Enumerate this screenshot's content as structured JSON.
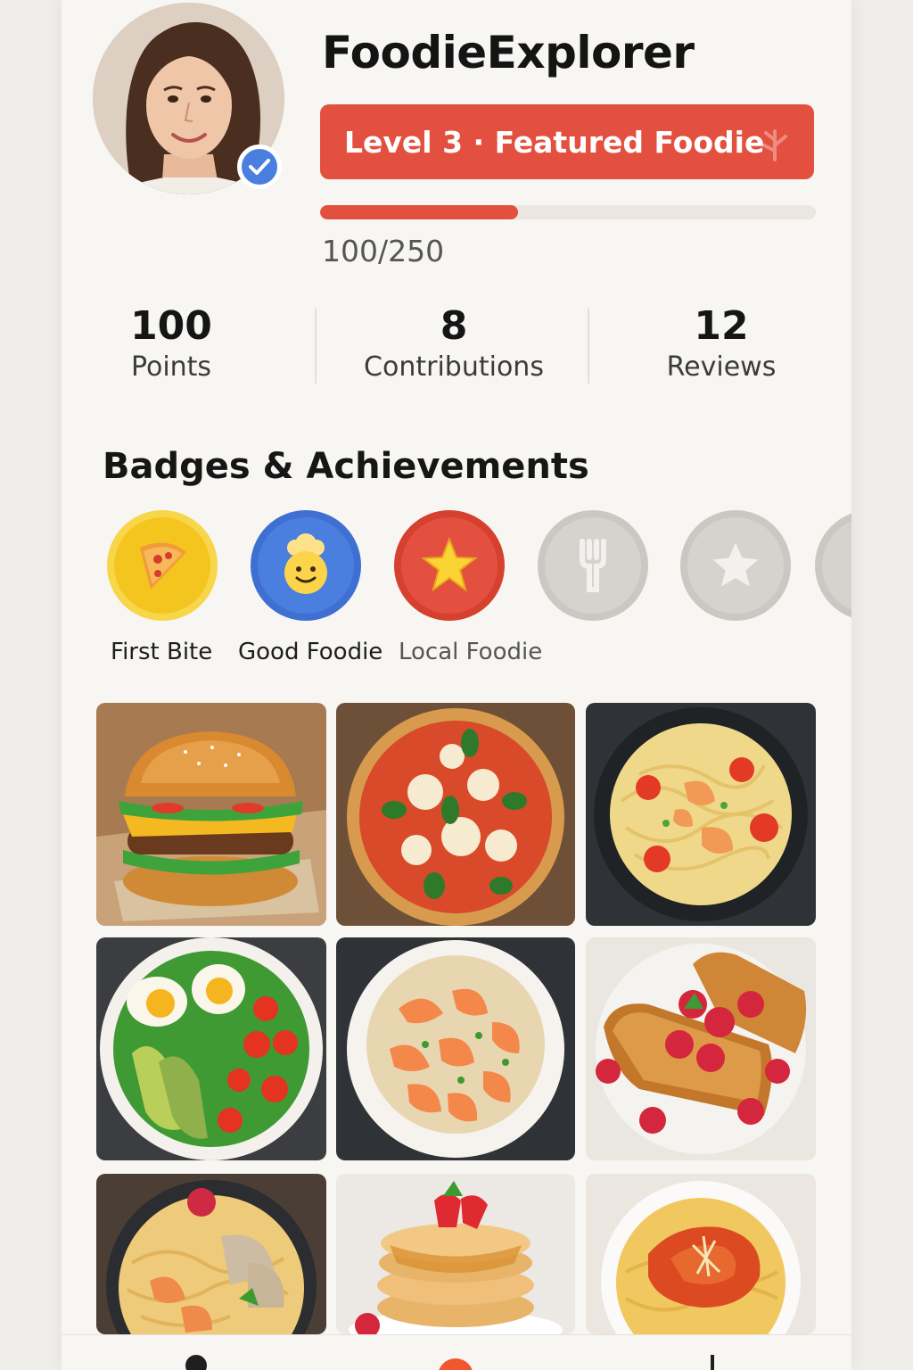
{
  "profile": {
    "username": "FoodieExplorer",
    "avatar_icon": "user-avatar-photo",
    "verified": true,
    "level_label": "Level 3 · Featured Foodie",
    "progress_current": 100,
    "progress_max": 250,
    "progress_text": "100/250"
  },
  "stats": [
    {
      "value": "100",
      "label": "Points"
    },
    {
      "value": "8",
      "label": "Contributions"
    },
    {
      "value": "12",
      "label": "Reviews"
    }
  ],
  "badges": {
    "title": "Badges & Achievements",
    "items": [
      {
        "label": "First Bite",
        "icon": "pizza-slice-icon",
        "earned": true
      },
      {
        "label": "Good Foodie",
        "icon": "chef-smiley-icon",
        "earned": true
      },
      {
        "label": "Local Foodie",
        "icon": "star-icon",
        "earned": true
      },
      {
        "label": "",
        "icon": "fork-icon",
        "earned": false
      },
      {
        "label": "",
        "icon": "star-icon",
        "earned": false
      },
      {
        "label": "",
        "icon": "locked-badge-icon",
        "earned": false
      }
    ]
  },
  "photos": [
    {
      "icon": "burger-photo"
    },
    {
      "icon": "pizza-photo"
    },
    {
      "icon": "shrimp-noodles-photo"
    },
    {
      "icon": "egg-avocado-salad-photo"
    },
    {
      "icon": "shrimp-bowl-photo"
    },
    {
      "icon": "french-toast-raspberries-photo"
    },
    {
      "icon": "shrimp-ramen-photo"
    },
    {
      "icon": "pancakes-strawberry-photo"
    },
    {
      "icon": "spaghetti-photo"
    }
  ],
  "nav": {
    "items": [
      {
        "icon": "profile-nav-icon"
      },
      {
        "icon": "home-nav-icon"
      },
      {
        "icon": "more-nav-icon"
      }
    ]
  },
  "colors": {
    "accent": "#e4503f",
    "verify_blue": "#4a7fe0",
    "badge_yellow": "#f5c51f",
    "badge_blue": "#4a7fe0",
    "badge_red": "#e4503f",
    "badge_locked": "#d6d3cf"
  }
}
